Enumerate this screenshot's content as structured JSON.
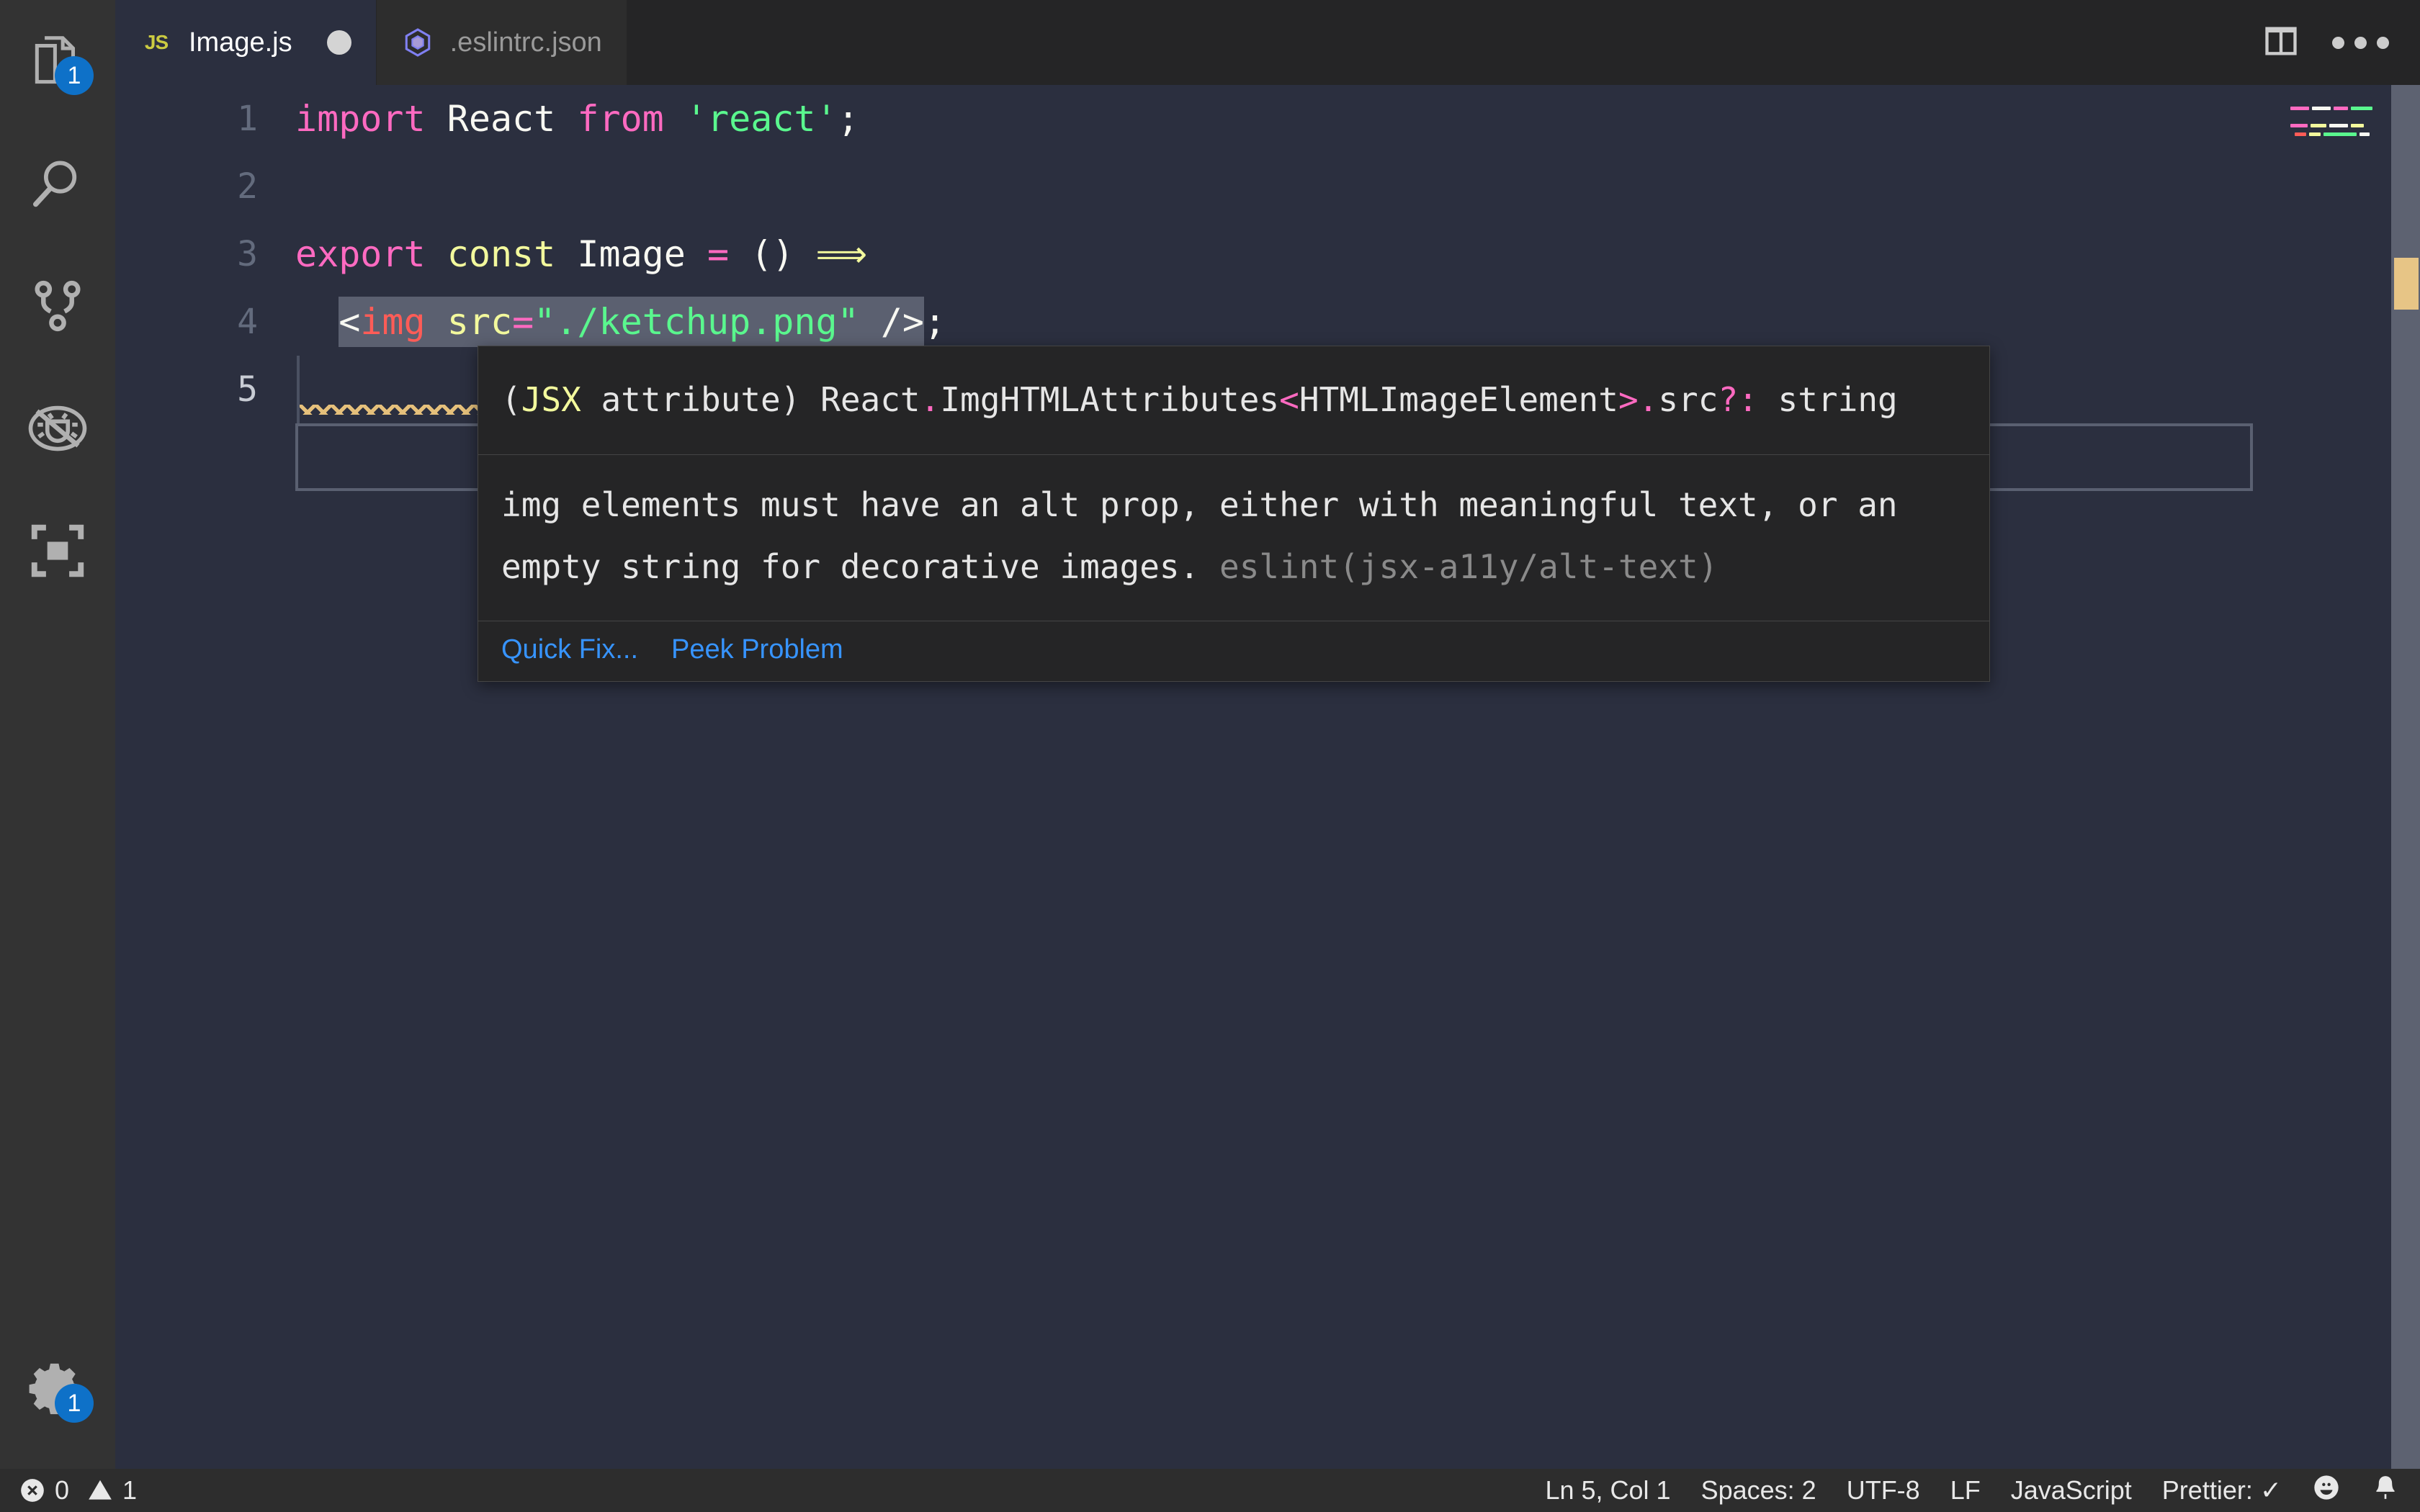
{
  "app": {
    "theme_bg": "#2b2f3f",
    "accent": "#0e71c8",
    "link_color": "#3794ff"
  },
  "activity_bar": {
    "items": [
      {
        "name": "explorer",
        "icon": "files-icon",
        "badge": "1"
      },
      {
        "name": "search",
        "icon": "search-icon",
        "badge": ""
      },
      {
        "name": "source-control",
        "icon": "source-control-icon",
        "badge": ""
      },
      {
        "name": "run-debug",
        "icon": "run-debug-icon",
        "badge": ""
      },
      {
        "name": "extensions",
        "icon": "extensions-icon",
        "badge": ""
      }
    ],
    "bottom": [
      {
        "name": "manage",
        "icon": "gear-icon",
        "badge": "1"
      }
    ]
  },
  "tabs": [
    {
      "label": "Image.js",
      "icon": "js-icon",
      "icon_text": "JS",
      "dirty": true,
      "active": true
    },
    {
      "label": ".eslintrc.json",
      "icon": "eslint-icon",
      "dirty": false,
      "active": false
    }
  ],
  "editor_actions": [
    {
      "name": "split-editor-right",
      "icon": "split-editor-icon"
    },
    {
      "name": "more-actions",
      "icon": "ellipsis-icon"
    }
  ],
  "code": {
    "lines": [
      {
        "number": "1",
        "text": "import React from 'react';"
      },
      {
        "number": "2",
        "text": ""
      },
      {
        "number": "3",
        "text": "export const Image = () ⟹"
      },
      {
        "number": "4",
        "text": "  <img src=\"./ketchup.png\" />;"
      },
      {
        "number": "5",
        "text": ""
      }
    ],
    "selection_text": "<img src=\"./ketchup.png\" />",
    "tokens": {
      "line1": {
        "kw_import": "import",
        "ident_react": "React",
        "kw_from": "from",
        "str_react": "'react'",
        "semi": ";"
      },
      "line3": {
        "kw_export": "export",
        "kw_const": "const",
        "ident_image": "Image",
        "eq": "=",
        "parens": "()",
        "arrow": "⟹"
      },
      "line4": {
        "lt": "<",
        "tag": "img",
        "attr": "src",
        "eq": "=",
        "value": "\"./ketchup.png\"",
        "close": "/>",
        "semi": ";"
      }
    },
    "active_line": "5"
  },
  "hover": {
    "signature": {
      "prefix": "(",
      "jsx": "JSX",
      "attribute": " attribute) React",
      "dot1": ".",
      "type_name": "ImgHTMLAttributes",
      "lt": "<",
      "generic": "HTMLImageElement",
      "gt": ">",
      "dot2": ".",
      "prop": "src",
      "optional": "?",
      "colon": ":",
      "value_type": " string",
      "full": "(JSX attribute) React.ImgHTMLAttributes<HTMLImageElement>.src?: string"
    },
    "message": "img elements must have an alt prop, either with meaningful text, or an empty string for decorative images.",
    "rule": "eslint(jsx-a11y/alt-text)",
    "actions": [
      {
        "label": "Quick Fix...",
        "name": "quick-fix-link"
      },
      {
        "label": "Peek Problem",
        "name": "peek-problem-link"
      }
    ]
  },
  "status_bar": {
    "problems": {
      "errors": "0",
      "warnings": "1"
    },
    "right_items": [
      {
        "name": "editor-position",
        "label": "Ln 5, Col 1"
      },
      {
        "name": "indentation",
        "label": "Spaces: 2"
      },
      {
        "name": "encoding",
        "label": "UTF-8"
      },
      {
        "name": "eol",
        "label": "LF"
      },
      {
        "name": "language-mode",
        "label": "JavaScript"
      },
      {
        "name": "prettier-status",
        "label": "Prettier: ✓"
      }
    ],
    "feedback_icon": "smiley-icon",
    "notifications_icon": "bell-icon"
  }
}
